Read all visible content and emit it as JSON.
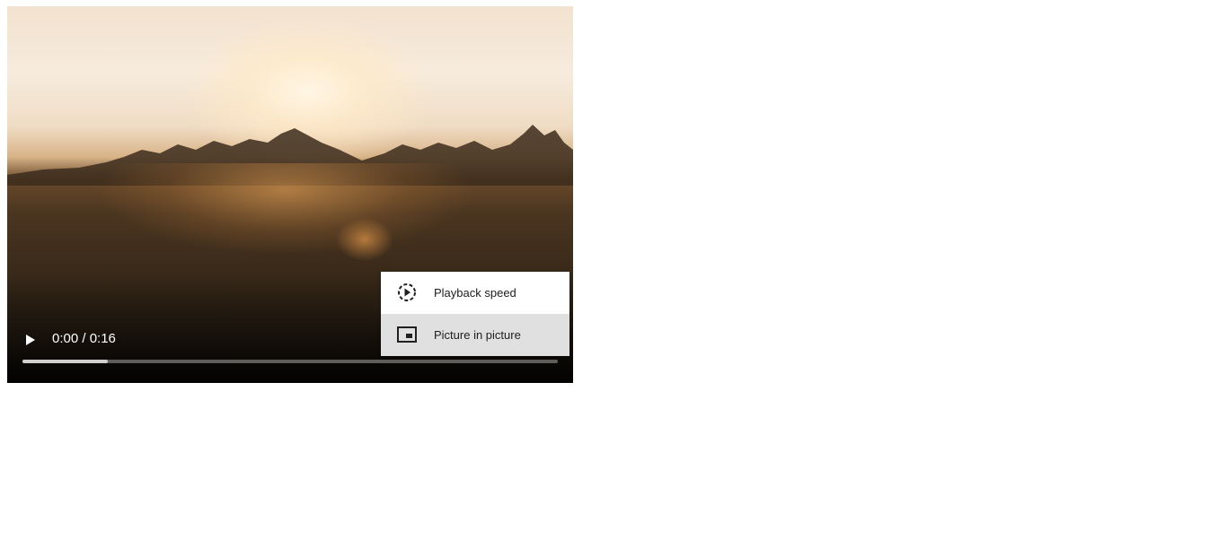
{
  "video": {
    "current_time": "0:00 / 0:16",
    "progress_fraction": 0,
    "buffered_fraction": 0.16
  },
  "menu": {
    "items": [
      {
        "label": "Playback speed",
        "icon": "playback-speed-icon",
        "highlighted": false
      },
      {
        "label": "Picture in picture",
        "icon": "picture-in-picture-icon",
        "highlighted": true
      }
    ]
  },
  "colors": {
    "menu_background": "#ffffff",
    "menu_highlight": "#e0e0e0",
    "control_text": "#ffffff"
  }
}
